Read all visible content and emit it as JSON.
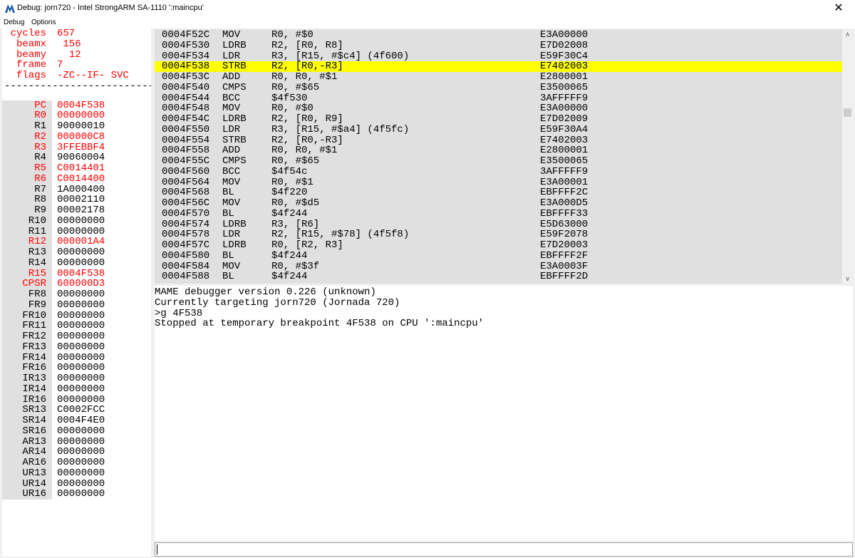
{
  "window": {
    "title": "Debug: jorn720 - Intel StrongARM SA-1110 ':maincpu'",
    "close_glyph": "✕"
  },
  "menu": {
    "items": [
      "Debug",
      "Options"
    ]
  },
  "state": {
    "counters": [
      {
        "label": "cycles",
        "value": "657"
      },
      {
        "label": "beamx",
        "value": " 156"
      },
      {
        "label": "beamy",
        "value": "  12"
      },
      {
        "label": "frame",
        "value": "7"
      },
      {
        "label": "flags",
        "value": "-ZC--IF- SVC"
      }
    ],
    "divider": "-------------------------",
    "registers": [
      {
        "label": "PC",
        "value": "0004F538",
        "changed": true
      },
      {
        "label": "R0",
        "value": "00000000",
        "changed": true
      },
      {
        "label": "R1",
        "value": "90000010",
        "changed": false
      },
      {
        "label": "R2",
        "value": "000000C8",
        "changed": true
      },
      {
        "label": "R3",
        "value": "3FFEBBF4",
        "changed": true
      },
      {
        "label": "R4",
        "value": "90060004",
        "changed": false
      },
      {
        "label": "R5",
        "value": "C0014401",
        "changed": true
      },
      {
        "label": "R6",
        "value": "C0014400",
        "changed": true
      },
      {
        "label": "R7",
        "value": "1A000400",
        "changed": false
      },
      {
        "label": "R8",
        "value": "00002110",
        "changed": false
      },
      {
        "label": "R9",
        "value": "00002178",
        "changed": false
      },
      {
        "label": "R10",
        "value": "00000000",
        "changed": false
      },
      {
        "label": "R11",
        "value": "00000000",
        "changed": false
      },
      {
        "label": "R12",
        "value": "000001A4",
        "changed": true
      },
      {
        "label": "R13",
        "value": "00000000",
        "changed": false
      },
      {
        "label": "R14",
        "value": "00000000",
        "changed": false
      },
      {
        "label": "R15",
        "value": "0004F538",
        "changed": true
      },
      {
        "label": "CPSR",
        "value": "600000D3",
        "changed": true
      },
      {
        "label": "FR8",
        "value": "00000000",
        "changed": false
      },
      {
        "label": "FR9",
        "value": "00000000",
        "changed": false
      },
      {
        "label": "FR10",
        "value": "00000000",
        "changed": false
      },
      {
        "label": "FR11",
        "value": "00000000",
        "changed": false
      },
      {
        "label": "FR12",
        "value": "00000000",
        "changed": false
      },
      {
        "label": "FR13",
        "value": "00000000",
        "changed": false
      },
      {
        "label": "FR14",
        "value": "00000000",
        "changed": false
      },
      {
        "label": "FR16",
        "value": "00000000",
        "changed": false
      },
      {
        "label": "IR13",
        "value": "00000000",
        "changed": false
      },
      {
        "label": "IR14",
        "value": "00000000",
        "changed": false
      },
      {
        "label": "IR16",
        "value": "00000000",
        "changed": false
      },
      {
        "label": "SR13",
        "value": "C0002FCC",
        "changed": false
      },
      {
        "label": "SR14",
        "value": "0004F4E0",
        "changed": false
      },
      {
        "label": "SR16",
        "value": "00000000",
        "changed": false
      },
      {
        "label": "AR13",
        "value": "00000000",
        "changed": false
      },
      {
        "label": "AR14",
        "value": "00000000",
        "changed": false
      },
      {
        "label": "AR16",
        "value": "00000000",
        "changed": false
      },
      {
        "label": "UR13",
        "value": "00000000",
        "changed": false
      },
      {
        "label": "UR14",
        "value": "00000000",
        "changed": false
      },
      {
        "label": "UR16",
        "value": "00000000",
        "changed": false
      }
    ]
  },
  "disasm": {
    "current_index": 3,
    "rows": [
      {
        "addr": "0004F52C",
        "op": "MOV",
        "args": "R0, #$0",
        "hex": "E3A00000"
      },
      {
        "addr": "0004F530",
        "op": "LDRB",
        "args": "R2, [R0, R8]",
        "hex": "E7D02008"
      },
      {
        "addr": "0004F534",
        "op": "LDR",
        "args": "R3, [R15, #$c4] (4f600)",
        "hex": "E59F30C4"
      },
      {
        "addr": "0004F538",
        "op": "STRB",
        "args": "R2, [R0,-R3]",
        "hex": "E7402003"
      },
      {
        "addr": "0004F53C",
        "op": "ADD",
        "args": "R0, R0, #$1",
        "hex": "E2800001"
      },
      {
        "addr": "0004F540",
        "op": "CMPS",
        "args": "R0, #$65",
        "hex": "E3500065"
      },
      {
        "addr": "0004F544",
        "op": "BCC",
        "args": "$4f530",
        "hex": "3AFFFFF9"
      },
      {
        "addr": "0004F548",
        "op": "MOV",
        "args": "R0, #$0",
        "hex": "E3A00000"
      },
      {
        "addr": "0004F54C",
        "op": "LDRB",
        "args": "R2, [R0, R9]",
        "hex": "E7D02009"
      },
      {
        "addr": "0004F550",
        "op": "LDR",
        "args": "R3, [R15, #$a4] (4f5fc)",
        "hex": "E59F30A4"
      },
      {
        "addr": "0004F554",
        "op": "STRB",
        "args": "R2, [R0,-R3]",
        "hex": "E7402003"
      },
      {
        "addr": "0004F558",
        "op": "ADD",
        "args": "R0, R0, #$1",
        "hex": "E2800001"
      },
      {
        "addr": "0004F55C",
        "op": "CMPS",
        "args": "R0, #$65",
        "hex": "E3500065"
      },
      {
        "addr": "0004F560",
        "op": "BCC",
        "args": "$4f54c",
        "hex": "3AFFFFF9"
      },
      {
        "addr": "0004F564",
        "op": "MOV",
        "args": "R0, #$1",
        "hex": "E3A00001"
      },
      {
        "addr": "0004F568",
        "op": "BL",
        "args": "$4f220",
        "hex": "EBFFFF2C"
      },
      {
        "addr": "0004F56C",
        "op": "MOV",
        "args": "R0, #$d5",
        "hex": "E3A000D5"
      },
      {
        "addr": "0004F570",
        "op": "BL",
        "args": "$4f244",
        "hex": "EBFFFF33"
      },
      {
        "addr": "0004F574",
        "op": "LDRB",
        "args": "R3, [R6]",
        "hex": "E5D63000"
      },
      {
        "addr": "0004F578",
        "op": "LDR",
        "args": "R2, [R15, #$78] (4f5f8)",
        "hex": "E59F2078"
      },
      {
        "addr": "0004F57C",
        "op": "LDRB",
        "args": "R0, [R2, R3]",
        "hex": "E7D20003"
      },
      {
        "addr": "0004F580",
        "op": "BL",
        "args": "$4f244",
        "hex": "EBFFFF2F"
      },
      {
        "addr": "0004F584",
        "op": "MOV",
        "args": "R0, #$3f",
        "hex": "E3A0003F"
      },
      {
        "addr": "0004F588",
        "op": "BL",
        "args": "$4f244",
        "hex": "EBFFFF2D"
      }
    ]
  },
  "console": {
    "lines": [
      "MAME debugger version 0.226 (unknown)",
      "Currently targeting jorn720 (Jornada 720)",
      ">g 4F538",
      "Stopped at temporary breakpoint 4F538 on CPU ':maincpu'"
    ]
  },
  "command": {
    "value": ""
  },
  "scrollbar": {
    "up_glyph": "∧",
    "down_glyph": "∨"
  },
  "colors": {
    "changed": "#ff0000",
    "highlight": "#ffff00",
    "panel_gray": "#e0e0e0"
  }
}
